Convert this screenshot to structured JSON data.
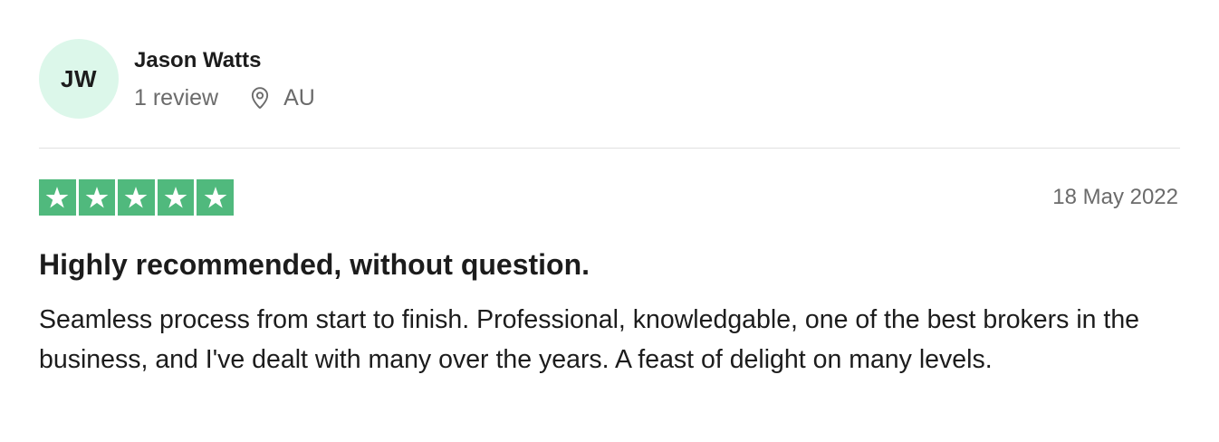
{
  "consumer": {
    "initials": "JW",
    "name": "Jason Watts",
    "review_count": "1 review",
    "location": "AU",
    "icons": {
      "location": "location-pin-icon"
    }
  },
  "review": {
    "rating": 5,
    "rating_max": 5,
    "date": "18 May 2022",
    "title": "Highly recommended, without question.",
    "body": "Seamless process from start to finish. Professional, knowledgable, one of the best brokers in the business, and I've dealt with many over the years. A feast of delight on many levels."
  },
  "colors": {
    "star_green": "#50b97d",
    "avatar_bg": "#dcf7ea",
    "text": "#1c1c1c",
    "muted": "#6b6b6b",
    "divider": "#e0e0e0"
  }
}
